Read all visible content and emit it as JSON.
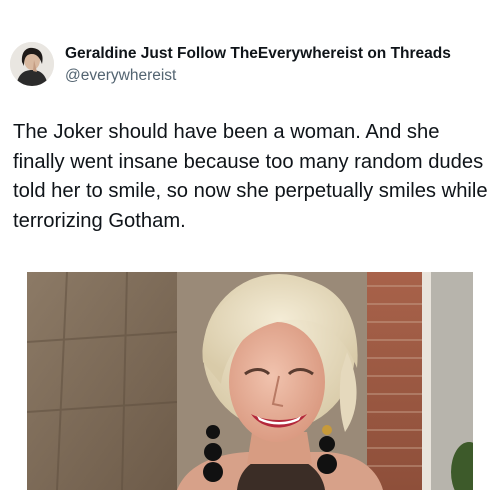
{
  "post": {
    "author": {
      "display_name": "Geraldine Just Follow TheEverywhereist on Threads",
      "handle": "@everywhereist"
    },
    "text": "The Joker should have been a woman. And she finally went insane because too many random dudes told her to smile, so now she perpetually smiles while terrorizing Gotham.",
    "media": {
      "type": "image",
      "subject": "photo-of-smiling-blonde-woman"
    }
  }
}
